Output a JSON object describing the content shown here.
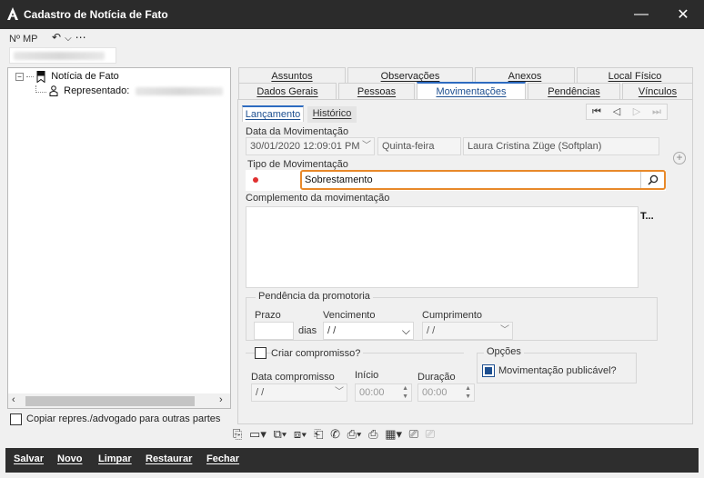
{
  "window": {
    "title": "Cadastro de Notícia de Fato",
    "minimize_icon": "minimize-icon",
    "close_icon": "close-icon"
  },
  "header": {
    "nmp_label": "Nº MP",
    "undo_icon": "undo-icon",
    "dropdown_icon": "chevron-down-icon",
    "more_icon": "more-icon"
  },
  "tree": {
    "root_label": "Notícia de Fato",
    "child_label": "Representado:"
  },
  "copy_checkbox_label": "Copiar repres./advogado para outras partes",
  "tabs_row1": [
    "Assuntos",
    "Observações",
    "Anexos",
    "Local Físico"
  ],
  "tabs_row2": [
    "Dados Gerais",
    "Pessoas",
    "Movimentações",
    "Pendências",
    "Vínculos"
  ],
  "subtabs": [
    "Lançamento",
    "Histórico"
  ],
  "movimentacao": {
    "data_label": "Data da Movimentação",
    "data_value": "30/01/2020 12:09:01 PM",
    "dia_value": "Quinta-feira",
    "usuario_value": "Laura Cristina Züge (Softplan)",
    "tipo_label": "Tipo de Movimentação",
    "tipo_value": "Sobrestamento",
    "complemento_label": "Complemento da movimentação",
    "complemento_side": "T..."
  },
  "pendencia": {
    "title": "Pendência da promotoria",
    "prazo_label": "Prazo",
    "dias_label": "dias",
    "vencimento_label": "Vencimento",
    "vencimento_value": " /  /",
    "cumprimento_label": "Cumprimento",
    "cumprimento_value": " /  /"
  },
  "compromisso": {
    "checkbox_label": "Criar compromisso?",
    "data_label": "Data compromisso",
    "data_value": " /  /",
    "inicio_label": "Início",
    "inicio_value": "00:00",
    "duracao_label": "Duração",
    "duracao_value": "00:00"
  },
  "opcoes": {
    "title": "Opções",
    "publicavel_label": "Movimentação publicável?"
  },
  "bottom_buttons": [
    "Salvar",
    "Novo",
    "Limpar",
    "Restaurar",
    "Fechar"
  ]
}
